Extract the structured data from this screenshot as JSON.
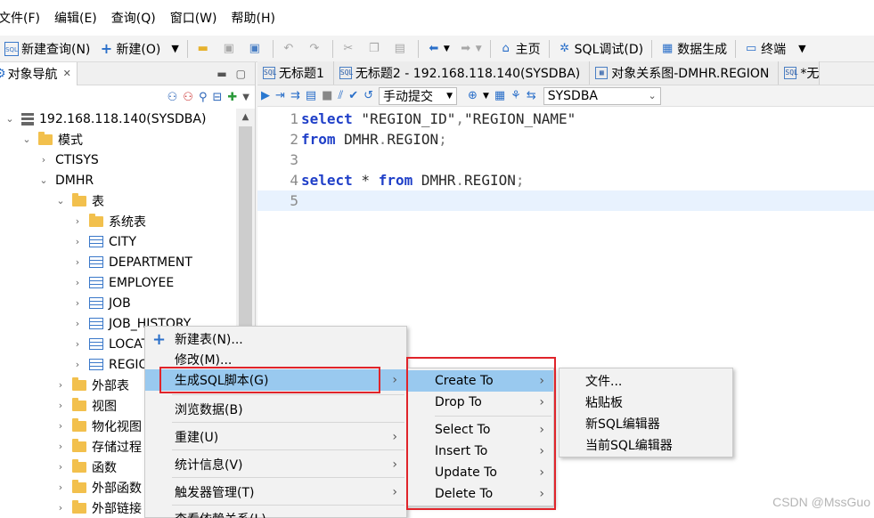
{
  "menubar": [
    "文件(F)",
    "编辑(E)",
    "查询(Q)",
    "窗口(W)",
    "帮助(H)"
  ],
  "toolbar": {
    "new_query": "新建查询(N)",
    "new": "新建(O)",
    "home": "主页",
    "sql_debug": "SQL调试(D)",
    "data_gen": "数据生成",
    "terminal": "终端"
  },
  "left_panel": {
    "tab_title": "对象导航",
    "tree": [
      {
        "label": "192.168.118.140(SYSDBA)",
        "type": "db",
        "expand": "down"
      },
      {
        "label": "模式",
        "type": "folder",
        "expand": "down"
      },
      {
        "label": "CTISYS",
        "type": "schema",
        "expand": "right"
      },
      {
        "label": "DMHR",
        "type": "schema",
        "expand": "down"
      },
      {
        "label": "表",
        "type": "folder",
        "expand": "down"
      },
      {
        "label": "系统表",
        "type": "folder",
        "expand": "right"
      },
      {
        "label": "CITY",
        "type": "table",
        "expand": "right"
      },
      {
        "label": "DEPARTMENT",
        "type": "table",
        "expand": "right"
      },
      {
        "label": "EMPLOYEE",
        "type": "table",
        "expand": "right"
      },
      {
        "label": "JOB",
        "type": "table",
        "expand": "right"
      },
      {
        "label": "JOB_HISTORY",
        "type": "table",
        "expand": "right"
      },
      {
        "label": "LOCAT",
        "type": "table",
        "expand": "right"
      },
      {
        "label": "REGION",
        "type": "table",
        "expand": "right"
      },
      {
        "label": "外部表",
        "type": "folder",
        "expand": "right"
      },
      {
        "label": "视图",
        "type": "folder",
        "expand": "right"
      },
      {
        "label": "物化视图",
        "type": "folder",
        "expand": "right"
      },
      {
        "label": "存储过程",
        "type": "folder",
        "expand": "right"
      },
      {
        "label": "函数",
        "type": "folder",
        "expand": "right"
      },
      {
        "label": "外部函数",
        "type": "folder",
        "expand": "right"
      },
      {
        "label": "外部链接",
        "type": "folder",
        "expand": "right"
      }
    ]
  },
  "editor": {
    "tabs": [
      "无标题1",
      "无标题2 - 192.168.118.140(SYSDBA)",
      "对象关系图-DMHR.REGION",
      "*无"
    ],
    "commit_mode": "手动提交",
    "schema": "SYSDBA",
    "lines": [
      {
        "num": "1",
        "tokens": [
          {
            "t": "select",
            "c": "kw"
          },
          {
            "t": " \"REGION_ID\"",
            "c": "str"
          },
          {
            "t": ",",
            "c": "punc"
          },
          {
            "t": "\"REGION_NAME\"",
            "c": "str"
          }
        ]
      },
      {
        "num": "2",
        "tokens": [
          {
            "t": "from",
            "c": "kw"
          },
          {
            "t": " DMHR",
            "c": "str"
          },
          {
            "t": ".",
            "c": "punc"
          },
          {
            "t": "REGION",
            "c": "str"
          },
          {
            "t": ";",
            "c": "punc"
          }
        ]
      },
      {
        "num": "3",
        "tokens": []
      },
      {
        "num": "4",
        "tokens": [
          {
            "t": "select",
            "c": "kw"
          },
          {
            "t": " * ",
            "c": "str"
          },
          {
            "t": "from",
            "c": "kw"
          },
          {
            "t": " DMHR",
            "c": "str"
          },
          {
            "t": ".",
            "c": "punc"
          },
          {
            "t": "REGION",
            "c": "str"
          },
          {
            "t": ";",
            "c": "punc"
          }
        ]
      },
      {
        "num": "5",
        "tokens": []
      }
    ]
  },
  "context_menu": [
    {
      "label": "新建表(N)...",
      "icon": "plus-icon"
    },
    {
      "label": "修改(M)..."
    },
    {
      "label": "生成SQL脚本(G)",
      "submenu": true
    },
    {
      "label": "浏览数据(B)"
    },
    {
      "label": "重建(U)",
      "submenu": true
    },
    {
      "label": "统计信息(V)",
      "submenu": true
    },
    {
      "label": "触发器管理(T)",
      "submenu": true
    },
    {
      "label": "查看依赖关系(L)"
    }
  ],
  "submenu": [
    "Create To",
    "Drop To",
    "Select To",
    "Insert To",
    "Update To",
    "Delete To"
  ],
  "submenu2": [
    "文件...",
    "粘贴板",
    "新SQL编辑器",
    "当前SQL编辑器"
  ],
  "watermark": "CSDN @MssGuo",
  "colors": {
    "highlight": "#99c9ef",
    "annotation": "#e0242a",
    "keyword": "#1f3fc8"
  }
}
